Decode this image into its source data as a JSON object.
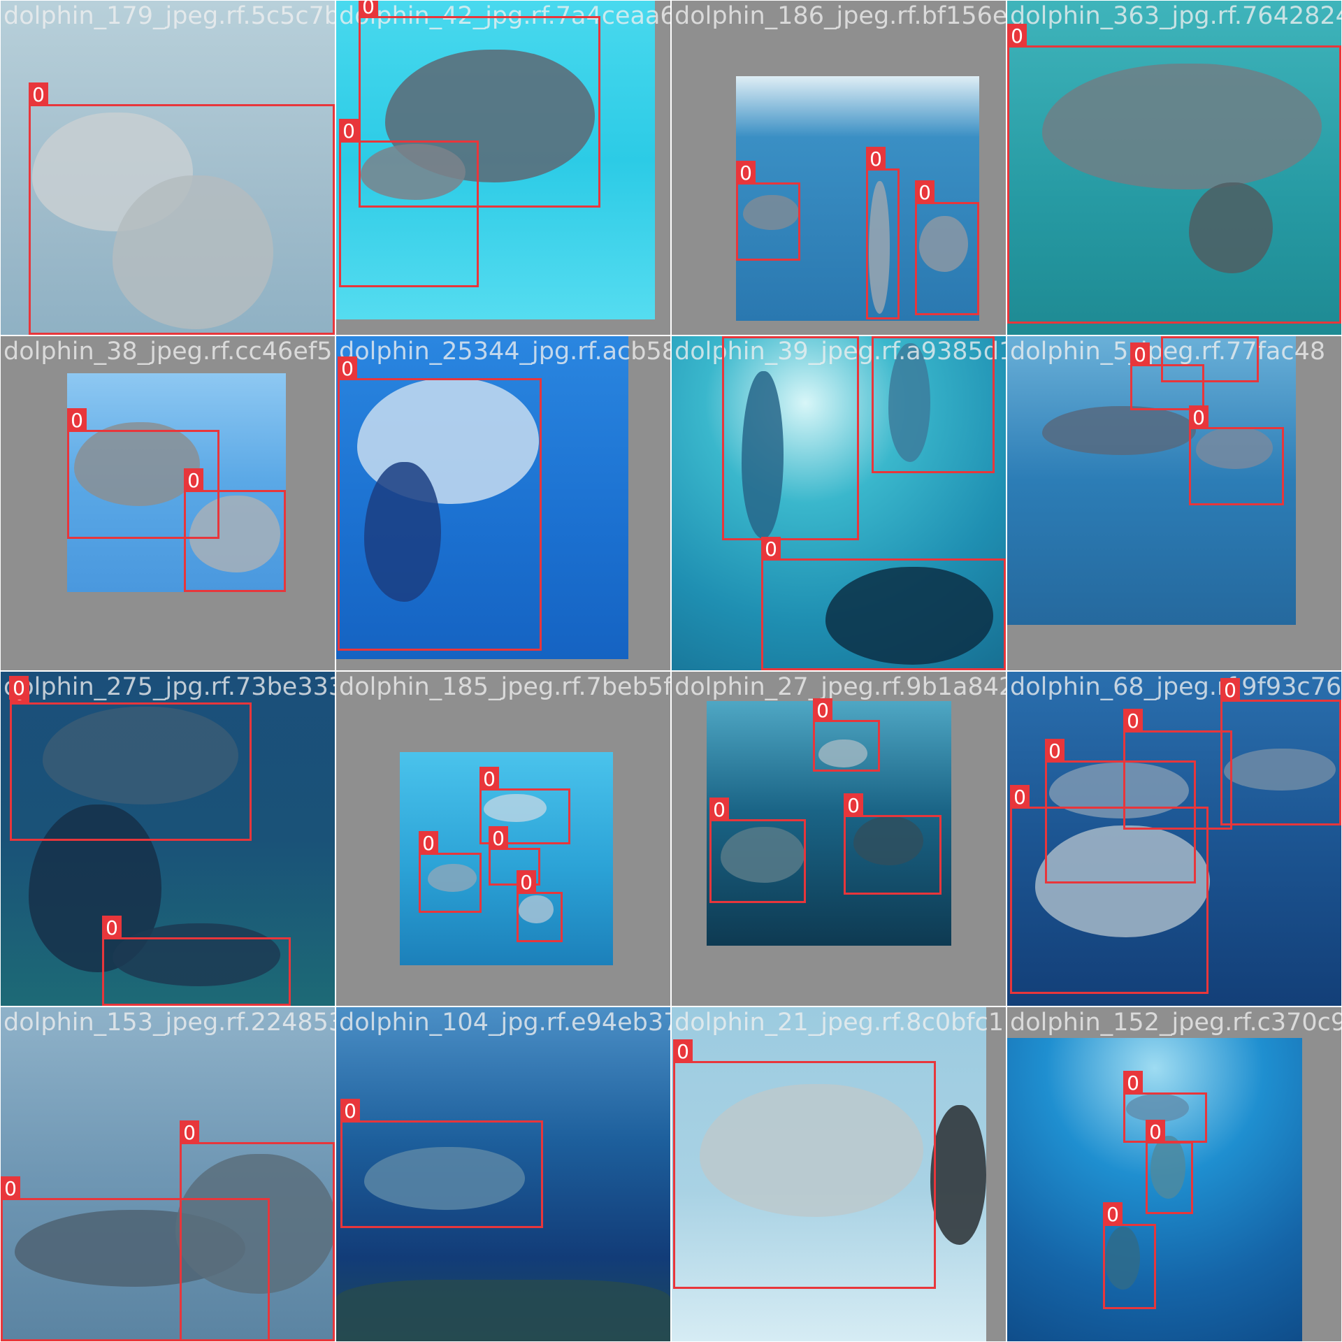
{
  "mosaic": {
    "tiles": [
      {
        "filename": "dolphin_179_jpeg.rf.5c5c7b9d21fdd12bde36f.7a4",
        "photo_color": "#a9c3cf",
        "detections": [
          {
            "label": "0"
          }
        ]
      },
      {
        "filename": "dolphin_42_jpg.rf.7a4ceaa6769117ef186a83",
        "photo_color": "#37cde4",
        "detections": [
          {
            "label": "0"
          },
          {
            "label": "0"
          }
        ]
      },
      {
        "filename": "dolphin_186_jpeg.rf.bf156efb79ab53626d.jpg",
        "photo_color": "#2f86b8",
        "detections": [
          {
            "label": "0"
          },
          {
            "label": "0"
          },
          {
            "label": "0"
          }
        ]
      },
      {
        "filename": "dolphin_363_jpg.rf.7642824c",
        "photo_color": "#2aa3ad",
        "detections": [
          {
            "label": "0"
          }
        ]
      },
      {
        "filename": "dolphin_38_jpeg.rf.cc46ef51",
        "photo_color": "#5aa8e6",
        "detections": [
          {
            "label": "0"
          },
          {
            "label": "0"
          }
        ]
      },
      {
        "filename": "dolphin_25344_jpg.rf.acb58696",
        "photo_color": "#1b74d3",
        "detections": [
          {
            "label": "0"
          }
        ]
      },
      {
        "filename": "dolphin_39_jpeg.rf.a9385d12",
        "photo_color": "#1f8fb2",
        "detections": [
          {
            "label": "0"
          },
          {
            "label": "0"
          },
          {
            "label": "0"
          }
        ]
      },
      {
        "filename": "dolphin_5_jpeg.rf.77fac48",
        "photo_color": "#2c7db6",
        "detections": [
          {
            "label": "0"
          },
          {
            "label": "0"
          },
          {
            "label": "0"
          }
        ]
      },
      {
        "filename": "dolphin_275_jpg.rf.73be3339",
        "photo_color": "#1a4f78",
        "detections": [
          {
            "label": "0"
          },
          {
            "label": "0"
          },
          {
            "label": "0"
          }
        ]
      },
      {
        "filename": "dolphin_185_jpeg.rf.7beb5f9",
        "photo_color": "#2ba2d6",
        "detections": [
          {
            "label": "0"
          },
          {
            "label": "0"
          },
          {
            "label": "0"
          },
          {
            "label": "0"
          }
        ]
      },
      {
        "filename": "dolphin_27_jpeg.rf.9b1a842",
        "photo_color": "#1a6486",
        "detections": [
          {
            "label": "0"
          },
          {
            "label": "0"
          },
          {
            "label": "0"
          }
        ]
      },
      {
        "filename": "dolphin_68_jpeg.rf.9f93c76b",
        "photo_color": "#1c5592",
        "detections": [
          {
            "label": "0"
          },
          {
            "label": "0"
          },
          {
            "label": "0"
          },
          {
            "label": "0"
          }
        ]
      },
      {
        "filename": "dolphin_153_jpeg.rf.224853",
        "photo_color": "#6f97b4",
        "detections": [
          {
            "label": "0"
          },
          {
            "label": "0"
          }
        ]
      },
      {
        "filename": "dolphin_104_jpg.rf.e94eb37",
        "photo_color": "#1d5f9c",
        "detections": [
          {
            "label": "0"
          }
        ]
      },
      {
        "filename": "dolphin_21_jpeg.rf.8c0bfc1",
        "photo_color": "#a9d2e4",
        "detections": [
          {
            "label": "0"
          }
        ]
      },
      {
        "filename": "dolphin_152_jpeg.rf.c370c9c",
        "photo_color": "#157bbc",
        "detections": [
          {
            "label": "0"
          },
          {
            "label": "0"
          },
          {
            "label": "0"
          }
        ]
      }
    ]
  }
}
